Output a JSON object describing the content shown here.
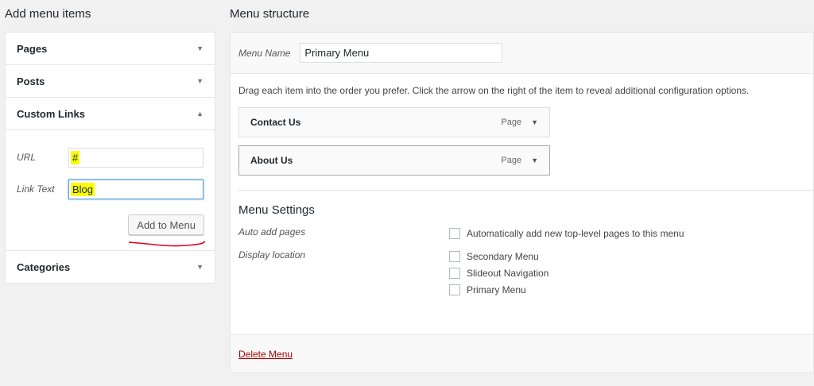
{
  "left": {
    "title": "Add menu items",
    "sections": [
      {
        "label": "Pages"
      },
      {
        "label": "Posts"
      },
      {
        "label": "Custom Links"
      },
      {
        "label": "Categories"
      }
    ],
    "custom_links": {
      "url_label": "URL",
      "url_value": "#",
      "link_text_label": "Link Text",
      "link_text_value": "Blog",
      "add_button": "Add to Menu"
    }
  },
  "right": {
    "title": "Menu structure",
    "menu_name_label": "Menu Name",
    "menu_name_value": "Primary Menu",
    "instructions": "Drag each item into the order you prefer. Click the arrow on the right of the item to reveal additional configuration options.",
    "items": [
      {
        "title": "Contact Us",
        "type": "Page"
      },
      {
        "title": "About Us",
        "type": "Page"
      }
    ],
    "settings": {
      "heading": "Menu Settings",
      "auto_add_label": "Auto add pages",
      "auto_add_option": "Automatically add new top-level pages to this menu",
      "display_location_label": "Display location",
      "locations": [
        "Secondary Menu",
        "Slideout Navigation",
        "Primary Menu"
      ]
    },
    "delete_link": "Delete Menu"
  },
  "colors": {
    "highlight": "#ffff00",
    "delete_link": "#aa0000",
    "annotation_underline": "#e2001a"
  }
}
